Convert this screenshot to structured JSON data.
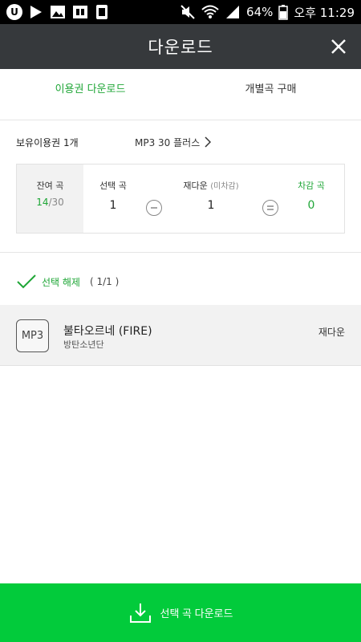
{
  "status_bar": {
    "battery": "64%",
    "time": "오후 11:29"
  },
  "header": {
    "title": "다운로드"
  },
  "tabs": [
    {
      "label": "이용권 다운로드",
      "active": true
    },
    {
      "label": "개별곡 구매",
      "active": false
    }
  ],
  "voucher": {
    "label": "보유이용권 1개",
    "name": "MP3 30 플러스"
  },
  "summary": {
    "remain_label": "잔여 곡",
    "remain_used": "14",
    "remain_total": "/30",
    "selected_label": "선택 곡",
    "selected_value": "1",
    "redownload_label": "재다운",
    "redownload_sub": "(미차감)",
    "redownload_value": "1",
    "deduct_label": "차감 곡",
    "deduct_value": "0"
  },
  "selection": {
    "label": "선택 해제",
    "count_open": "( ",
    "count_selected": "1",
    "count_total": "/1 )"
  },
  "songs": [
    {
      "format": "MP3",
      "title": "불타오르네 (FIRE)",
      "artist": "방탄소년단",
      "status": "재다운"
    }
  ],
  "download_button": {
    "label": "선택 곡 다운로드"
  },
  "colors": {
    "accent": "#1ea636",
    "button": "#02cb3b",
    "header": "#36393c"
  }
}
